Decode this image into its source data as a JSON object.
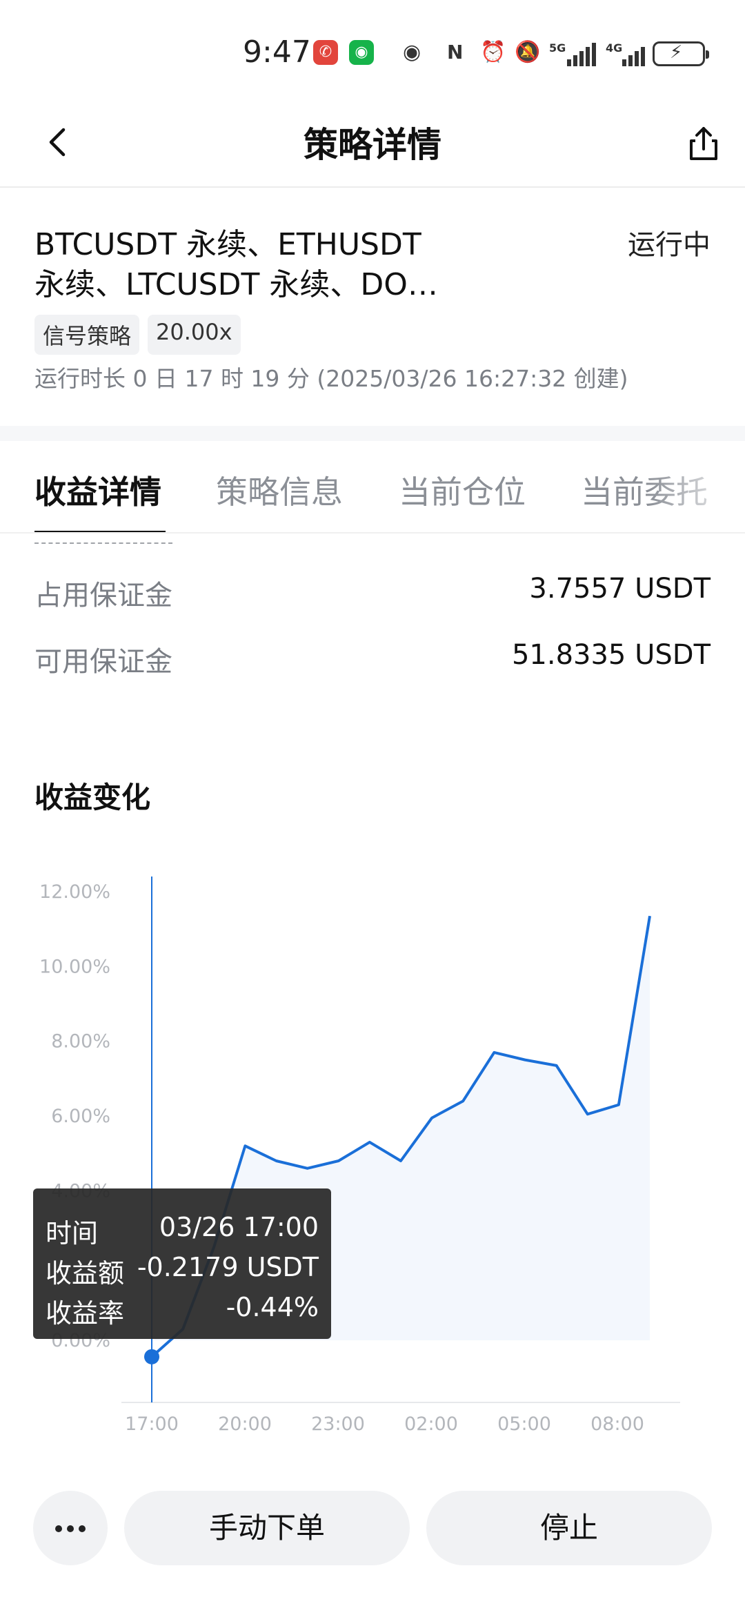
{
  "status_bar": {
    "time": "9:47",
    "network1": "5G",
    "network2": "4G",
    "icons": [
      "missed-call-icon",
      "wechat-icon",
      "eye-icon",
      "nfc-icon",
      "alarm-icon",
      "mute-icon",
      "signal-5g-icon",
      "signal-4g-icon",
      "battery-charging-icon"
    ]
  },
  "header": {
    "title": "策略详情",
    "back_icon": "chevron-left-icon",
    "share_icon": "share-icon"
  },
  "summary": {
    "pairs_line1": "BTCUSDT 永续、ETHUSDT",
    "pairs_line2": "永续、LTCUSDT 永续、DO…",
    "status": "运行中",
    "tag_type": "信号策略",
    "tag_leverage": "20.00x",
    "runtime": "运行时长 0 日 17 时 19 分 (2025/03/26 16:27:32 创建)"
  },
  "tabs": [
    {
      "label": "收益详情",
      "active": true
    },
    {
      "label": "策略信息",
      "active": false
    },
    {
      "label": "当前仓位",
      "active": false
    },
    {
      "label": "当前委托",
      "active": false
    }
  ],
  "details": [
    {
      "label": "占用保证金",
      "value": "3.7557 USDT"
    },
    {
      "label": "可用保证金",
      "value": "51.8335 USDT"
    }
  ],
  "section_title": "收益变化",
  "tooltip": {
    "time_label": "时间",
    "time_value": "03/26 17:00",
    "amount_label": "收益额",
    "amount_value": "-0.2179 USDT",
    "rate_label": "收益率",
    "rate_value": "-0.44%"
  },
  "chart_data": {
    "type": "area",
    "x_labels": [
      "17:00",
      "20:00",
      "23:00",
      "02:00",
      "05:00",
      "08:00"
    ],
    "y_labels": [
      "12.00%",
      "10.00%",
      "8.00%",
      "6.00%",
      "4.00%",
      "0.00%"
    ],
    "ylim": [
      0,
      12
    ],
    "series": [
      {
        "x": [
          0,
          1,
          2,
          3,
          4,
          5,
          6,
          7,
          8,
          9,
          10,
          11,
          12,
          13,
          14,
          15,
          16
        ],
        "values": [
          -0.44,
          0.3,
          2.5,
          5.2,
          4.8,
          4.6,
          4.8,
          5.3,
          4.8,
          5.95,
          6.4,
          7.7,
          7.5,
          7.35,
          6.05,
          6.3,
          11.35
        ]
      }
    ],
    "highlight_index": 0,
    "colors": {
      "line": "#1a6fd8",
      "fill": "#f3f7fd",
      "grid": "#e6e8eb",
      "tick": "#b3b6bb"
    }
  },
  "bottom_bar": {
    "more_icon": "more-horizontal-icon",
    "manual_label": "手动下单",
    "stop_label": "停止"
  }
}
